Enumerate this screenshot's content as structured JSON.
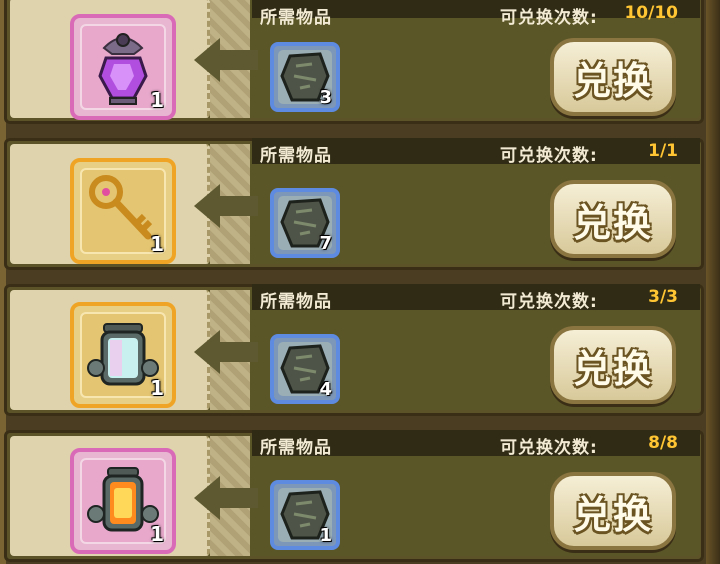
{
  "rows": [
    {
      "required_label": "所需物品",
      "count_label": "可兑换次数:",
      "count": "10/10",
      "reward_icon": "purple-potion-icon",
      "reward_qty": "1",
      "reward_frame": "pink",
      "cost_icon": "rune-stone-icon",
      "cost_qty": "3",
      "button": "兑换"
    },
    {
      "required_label": "所需物品",
      "count_label": "可兑换次数:",
      "count": "1/1",
      "reward_icon": "golden-key-icon",
      "reward_qty": "1",
      "reward_frame": "gold",
      "cost_icon": "rune-stone-icon",
      "cost_qty": "7",
      "button": "兑换"
    },
    {
      "required_label": "所需物品",
      "count_label": "可兑换次数:",
      "count": "3/3",
      "reward_icon": "crystal-lantern-icon",
      "reward_qty": "1",
      "reward_frame": "gold",
      "cost_icon": "rune-stone-icon",
      "cost_qty": "4",
      "button": "兑换"
    },
    {
      "required_label": "所需物品",
      "count_label": "可兑换次数:",
      "count": "8/8",
      "reward_icon": "fire-lantern-icon",
      "reward_qty": "1",
      "reward_frame": "pink",
      "cost_icon": "rune-stone-icon",
      "cost_qty": "1",
      "button": "兑换"
    }
  ],
  "colors": {
    "count": "#ffc533",
    "pink_frame": "#d96ab7",
    "gold_frame": "#f0a426",
    "cost_frame": "#5e8be0"
  }
}
